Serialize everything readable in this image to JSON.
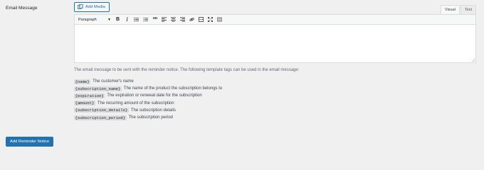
{
  "field": {
    "label": "Email Message"
  },
  "editor": {
    "add_media_label": "Add Media",
    "tabs": [
      "Visual",
      "Text"
    ],
    "format_selected": "Paragraph",
    "toolbar_icons": [
      "bold-icon",
      "italic-icon",
      "bullet-list-icon",
      "numbered-list-icon",
      "blockquote-icon",
      "align-left-icon",
      "align-center-icon",
      "align-right-icon",
      "link-icon",
      "read-more-icon",
      "fullscreen-icon",
      "toolbar-toggle-icon"
    ],
    "bold_glyph": "B",
    "italic_glyph": "I",
    "quote_glyph": "““"
  },
  "description": "The email message to be sent with the reminder notice. The following template tags can be used in the email message:",
  "tags": [
    {
      "code": "{name}",
      "text": "The customer's name"
    },
    {
      "code": "{subscription_name}",
      "text": "The name of the product the subscription belongs to"
    },
    {
      "code": "{expiration}",
      "text": "The expiration or renewal date for the subscription"
    },
    {
      "code": "{amount}",
      "text": "The recurring amount of the subscription"
    },
    {
      "code": "{subscription_details}",
      "text": "The subscription details"
    },
    {
      "code": "{subscription_period}",
      "text": "The subscription period"
    }
  ],
  "submit_label": "Add Reminder Notice",
  "colors": {
    "accent": "#2271b1",
    "background": "#f0f0f1"
  }
}
